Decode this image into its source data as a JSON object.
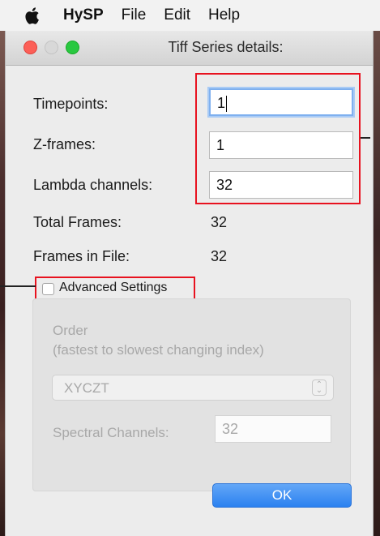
{
  "menubar": {
    "apple_icon": "apple-logo-icon",
    "app_name": "HySP",
    "items": [
      "File",
      "Edit",
      "Help"
    ]
  },
  "window": {
    "title": "Tiff Series details:"
  },
  "form": {
    "timepoints": {
      "label": "Timepoints:",
      "value": "1"
    },
    "zframes": {
      "label": "Z-frames:",
      "value": "1"
    },
    "lambda": {
      "label": "Lambda channels:",
      "value": "32"
    },
    "total_frames": {
      "label": "Total Frames:",
      "value": "32"
    },
    "frames_in_file": {
      "label": "Frames in File:",
      "value": "32"
    }
  },
  "advanced": {
    "label": "Advanced Settings",
    "checked": false,
    "order_label": "Order",
    "order_hint": "(fastest to slowest changing index)",
    "order_selected": "XYCZT",
    "spectral_label": "Spectral Channels:",
    "spectral_value": "32"
  },
  "buttons": {
    "ok": "OK"
  },
  "colors": {
    "highlight_box": "#e8121f",
    "ok_button": "#2b81f0",
    "focus_ring": "#7fb0ef"
  }
}
